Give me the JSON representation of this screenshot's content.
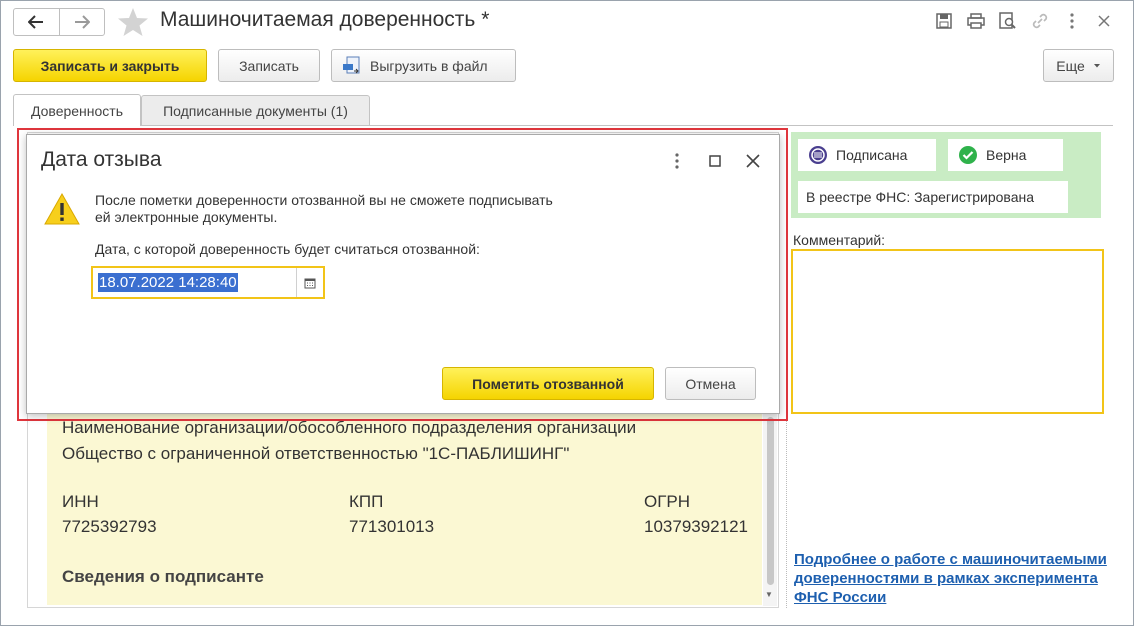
{
  "header": {
    "title": "Машиночитаемая доверенность *"
  },
  "toolbar": {
    "save_close": "Записать и закрыть",
    "save": "Записать",
    "export": "Выгрузить в файл",
    "more": "Еще"
  },
  "tabs": [
    {
      "label": "Доверенность"
    },
    {
      "label": "Подписанные документы (1)"
    }
  ],
  "content": {
    "org_heading": "Наименование организации/обособленного подразделения организации",
    "org_name": "Общество с ограниченной ответственностью \"1С-ПАБЛИШИНГ\"",
    "inn_label": "ИНН",
    "inn_value": "7725392793",
    "kpp_label": "КПП",
    "kpp_value": "771301013",
    "ogrn_label": "ОГРН",
    "ogrn_value": "10379392121",
    "signer_heading": "Сведения о подписанте"
  },
  "status": {
    "signed": "Подписана",
    "valid": "Верна",
    "registry": "В реестре ФНС: Зарегистрирована",
    "colors": {
      "panel": "#c9ecc4",
      "valid_icon": "#2fb24b",
      "signed_icon": "#4a3f8f"
    }
  },
  "comment": {
    "label": "Комментарий:",
    "value": ""
  },
  "more_link": "Подробнее о работе с машиночитаемыми доверенностями в рамках эксперимента ФНС России",
  "dialog": {
    "title": "Дата отзыва",
    "message": "После пометки доверенности отозванной вы не сможете подписывать ей электронные документы.",
    "date_label": "Дата, с которой доверенность будет считаться отозванной:",
    "date_value": "18.07.2022 14:28:40",
    "mark_button": "Пометить отозванной",
    "cancel_button": "Отмена"
  },
  "accent": {
    "primary_yellow": "#f5d400",
    "highlight_red": "#e0363d",
    "link_blue": "#1d5faf"
  }
}
